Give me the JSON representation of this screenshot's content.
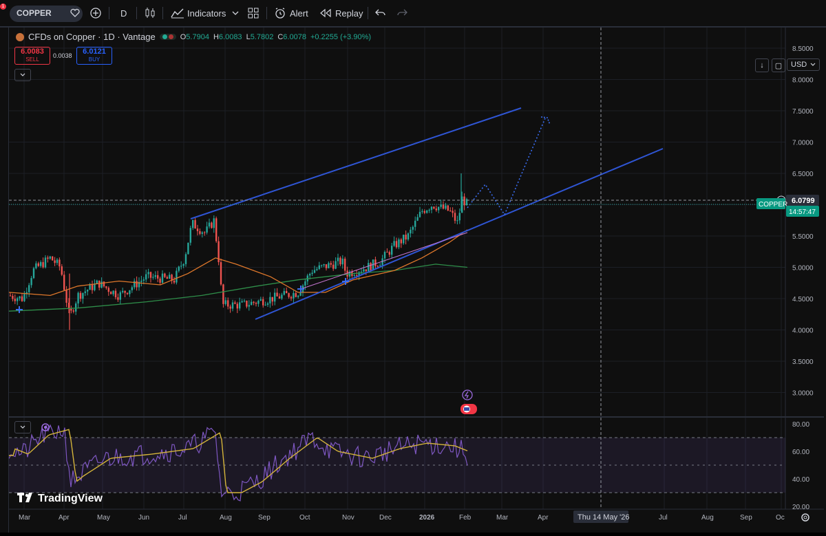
{
  "toolbar": {
    "symbol": "COPPER",
    "notification_count": "1",
    "interval": "D",
    "indicators_label": "Indicators",
    "alert_label": "Alert",
    "replay_label": "Replay"
  },
  "legend": {
    "title": "CFDs on Copper · 1D · Vantage",
    "o_label": "O",
    "o_value": "5.7904",
    "h_label": "H",
    "h_value": "6.0083",
    "l_label": "L",
    "l_value": "5.7802",
    "c_label": "C",
    "c_value": "6.0078",
    "change": "+0.2255 (+3.90%)",
    "sell_price": "6.0083",
    "sell_label": "SELL",
    "spread": "0.0038",
    "buy_price": "6.0121",
    "buy_label": "BUY"
  },
  "right_controls": {
    "currency": "USD"
  },
  "price_axis": {
    "ticks": [
      "8.5000",
      "8.0000",
      "7.5000",
      "7.0000",
      "6.5000",
      "6.0000",
      "5.5000",
      "5.0000",
      "4.5000",
      "4.0000",
      "3.5000",
      "3.0000"
    ],
    "crosshair_price": "6.0799",
    "last_price_tag": "COPPER",
    "countdown": "14:57:47"
  },
  "rsi_axis": {
    "ticks": [
      "80.00",
      "60.00",
      "40.00",
      "20.00"
    ]
  },
  "time_axis": {
    "ticks": [
      "Mar",
      "Apr",
      "May",
      "Jun",
      "Jul",
      "Aug",
      "Sep",
      "Oct",
      "Nov",
      "Dec",
      "2026",
      "Feb",
      "Mar",
      "Apr",
      "Jul",
      "Aug",
      "Sep",
      "Oc"
    ],
    "crosshair_label": "Thu 14 May '26"
  },
  "branding": {
    "logo": "TradingView"
  },
  "colors": {
    "up": "#26a69a",
    "down": "#ef5350",
    "channel": "#2f55d4",
    "ma_fast": "#e0782b",
    "ma_slow": "#2f8f4a",
    "rsi": "#7e57c2",
    "rsi_ma": "#d4b43a",
    "accent_green": "#089981",
    "background": "#0f0f0f"
  },
  "chart_data": {
    "type": "candlestick",
    "title": "CFDs on Copper · 1D · Vantage",
    "ylim": [
      2.7,
      8.6
    ],
    "x": [
      "Mar",
      "Apr",
      "May",
      "Jun",
      "Jul",
      "Aug",
      "Sep",
      "Oct",
      "Nov",
      "Dec",
      "2026",
      "Feb"
    ],
    "close": [
      4.55,
      4.85,
      4.45,
      4.6,
      4.75,
      5.0,
      5.55,
      4.45,
      4.55,
      5.0,
      5.1,
      5.0,
      5.4,
      5.9,
      6.0
    ],
    "ma_fast_approx": [
      4.6,
      4.7,
      4.75,
      4.8,
      5.05,
      4.8,
      4.6,
      4.7,
      4.85,
      5.0,
      5.2,
      5.6
    ],
    "ma_slow_approx": [
      4.3,
      4.35,
      4.4,
      4.45,
      4.55,
      4.6,
      4.7,
      4.8,
      4.85,
      4.95,
      5.0,
      5.1
    ],
    "channel_upper": {
      "from": [
        "Jul",
        5.75
      ],
      "to": [
        "Mar 2026",
        7.55
      ]
    },
    "channel_lower": {
      "from": [
        "Aug",
        4.15
      ],
      "to": [
        "Jun 2026",
        6.9
      ]
    },
    "rsi": {
      "range": [
        20,
        80
      ],
      "levels": [
        70,
        50,
        30
      ]
    }
  }
}
